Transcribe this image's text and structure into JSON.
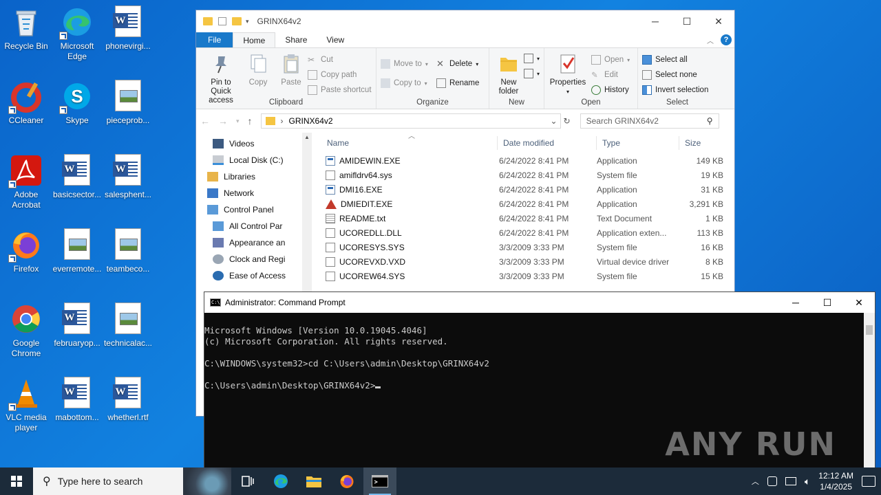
{
  "desktop": {
    "icons": [
      {
        "label": "Recycle Bin"
      },
      {
        "label": "Microsoft Edge"
      },
      {
        "label": "phonevirgi..."
      },
      {
        "label": "CCleaner"
      },
      {
        "label": "Skype"
      },
      {
        "label": "pieceprob..."
      },
      {
        "label": "Adobe Acrobat"
      },
      {
        "label": "basicsector..."
      },
      {
        "label": "salesphent..."
      },
      {
        "label": "Firefox"
      },
      {
        "label": "everremote..."
      },
      {
        "label": "teambeco..."
      },
      {
        "label": "Google Chrome"
      },
      {
        "label": "februaryop..."
      },
      {
        "label": "technicalac..."
      },
      {
        "label": "VLC media player"
      },
      {
        "label": "mabottom..."
      },
      {
        "label": "whetherl.rtf"
      }
    ]
  },
  "explorer": {
    "title": "GRINX64v2",
    "tabs": {
      "file": "File",
      "home": "Home",
      "share": "Share",
      "view": "View"
    },
    "ribbon": {
      "pin": "Pin to Quick access",
      "copy": "Copy",
      "paste": "Paste",
      "cut": "Cut",
      "copy_path": "Copy path",
      "paste_shortcut": "Paste shortcut",
      "clipboard": "Clipboard",
      "move_to": "Move to",
      "copy_to": "Copy to",
      "delete": "Delete",
      "rename": "Rename",
      "organize": "Organize",
      "new_folder": "New folder",
      "new": "New",
      "properties": "Properties",
      "open": "Open",
      "edit": "Edit",
      "history": "History",
      "open_group": "Open",
      "select_all": "Select all",
      "select_none": "Select none",
      "invert_selection": "Invert selection",
      "select": "Select"
    },
    "address": "GRINX64v2",
    "search_placeholder": "Search GRINX64v2",
    "nav": [
      {
        "label": "Videos"
      },
      {
        "label": "Local Disk (C:)"
      },
      {
        "label": "Libraries"
      },
      {
        "label": "Network"
      },
      {
        "label": "Control Panel"
      },
      {
        "label": "All Control Par"
      },
      {
        "label": "Appearance an"
      },
      {
        "label": "Clock and Regi"
      },
      {
        "label": "Ease of Access"
      }
    ],
    "columns": {
      "name": "Name",
      "date": "Date modified",
      "type": "Type",
      "size": "Size"
    },
    "files": [
      {
        "name": "AMIDEWIN.EXE",
        "date": "6/24/2022 8:41 PM",
        "type": "Application",
        "size": "149 KB",
        "icon": "app"
      },
      {
        "name": "amifldrv64.sys",
        "date": "6/24/2022 8:41 PM",
        "type": "System file",
        "size": "19 KB",
        "icon": "sys"
      },
      {
        "name": "DMI16.EXE",
        "date": "6/24/2022 8:41 PM",
        "type": "Application",
        "size": "31 KB",
        "icon": "app"
      },
      {
        "name": "DMIEDIT.EXE",
        "date": "6/24/2022 8:41 PM",
        "type": "Application",
        "size": "3,291 KB",
        "icon": "warn"
      },
      {
        "name": "README.txt",
        "date": "6/24/2022 8:41 PM",
        "type": "Text Document",
        "size": "1 KB",
        "icon": "txt"
      },
      {
        "name": "UCOREDLL.DLL",
        "date": "6/24/2022 8:41 PM",
        "type": "Application exten...",
        "size": "113 KB",
        "icon": "sys"
      },
      {
        "name": "UCORESYS.SYS",
        "date": "3/3/2009 3:33 PM",
        "type": "System file",
        "size": "16 KB",
        "icon": "sys"
      },
      {
        "name": "UCOREVXD.VXD",
        "date": "3/3/2009 3:33 PM",
        "type": "Virtual device driver",
        "size": "8 KB",
        "icon": "sys"
      },
      {
        "name": "UCOREW64.SYS",
        "date": "3/3/2009 3:33 PM",
        "type": "System file",
        "size": "15 KB",
        "icon": "sys"
      }
    ]
  },
  "cmd": {
    "title": "Administrator: Command Prompt",
    "lines": [
      "Microsoft Windows [Version 10.0.19045.4046]",
      "(c) Microsoft Corporation. All rights reserved.",
      "",
      "C:\\WINDOWS\\system32>cd C:\\Users\\admin\\Desktop\\GRINX64v2",
      "",
      "C:\\Users\\admin\\Desktop\\GRINX64v2>"
    ],
    "watermark": "ANY RUN"
  },
  "taskbar": {
    "search_placeholder": "Type here to search",
    "time": "12:12 AM",
    "date": "1/4/2025"
  }
}
